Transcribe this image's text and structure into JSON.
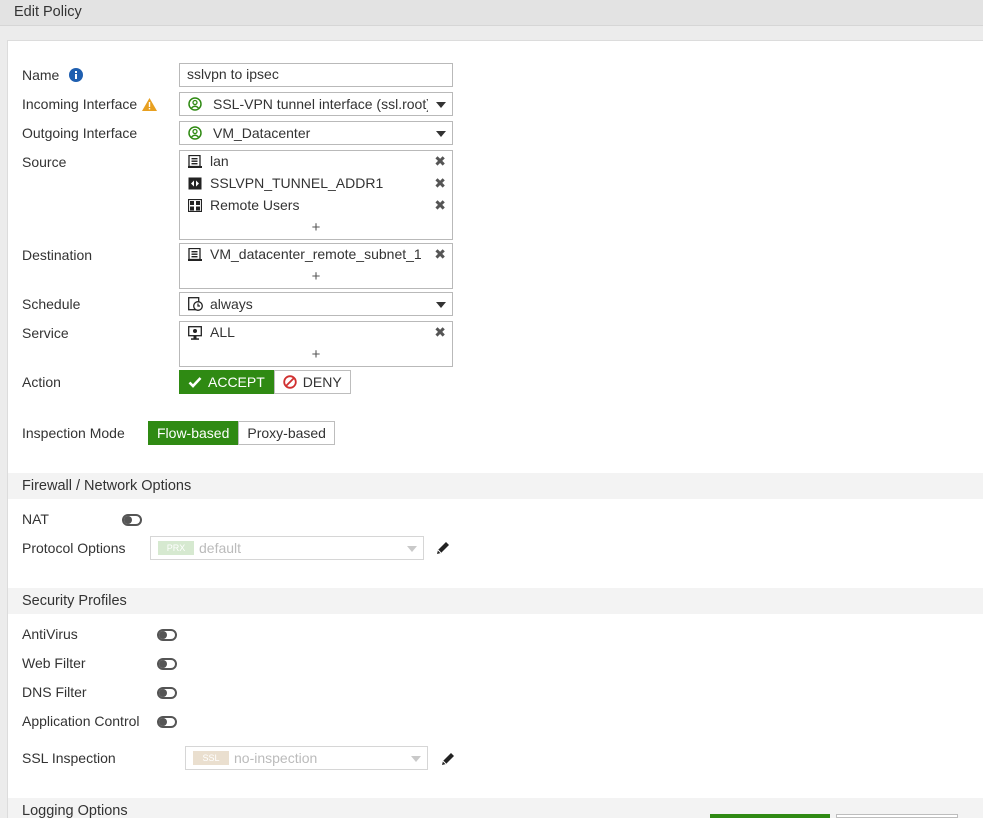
{
  "title": "Edit Policy",
  "form": {
    "name": {
      "label": "Name",
      "value": "sslvpn to ipsec"
    },
    "incoming": {
      "label": "Incoming Interface",
      "value": "SSL-VPN tunnel interface (ssl.root)"
    },
    "outgoing": {
      "label": "Outgoing Interface",
      "value": "VM_Datacenter"
    },
    "source": {
      "label": "Source",
      "items": [
        "lan",
        "SSLVPN_TUNNEL_ADDR1",
        "Remote Users"
      ]
    },
    "destination": {
      "label": "Destination",
      "items": [
        "VM_datacenter_remote_subnet_1"
      ]
    },
    "schedule": {
      "label": "Schedule",
      "value": "always"
    },
    "service": {
      "label": "Service",
      "items": [
        "ALL"
      ]
    },
    "action": {
      "label": "Action",
      "accept": "ACCEPT",
      "deny": "DENY",
      "selected": "ACCEPT"
    },
    "inspection": {
      "label": "Inspection Mode",
      "flow": "Flow-based",
      "proxy": "Proxy-based",
      "selected": "Flow-based"
    },
    "add_symbol": "+",
    "remove_symbol": "✖"
  },
  "firewall": {
    "section_title": "Firewall / Network Options",
    "nat_label": "NAT",
    "nat_enabled": false,
    "protocol_label": "Protocol Options",
    "protocol_tag": "PRX",
    "protocol_value": "default"
  },
  "security": {
    "section_title": "Security Profiles",
    "antivirus": "AntiVirus",
    "webfilter": "Web Filter",
    "dnsfilter": "DNS Filter",
    "appcontrol": "Application Control",
    "ssl_label": "SSL Inspection",
    "ssl_tag": "SSL",
    "ssl_value": "no-inspection"
  },
  "logging": {
    "section_title": "Logging Options"
  },
  "colors": {
    "accept_green": "#2f8a13",
    "deny_red": "#d03030",
    "info_blue": "#1f5fb0",
    "warn_orange": "#e8a020"
  }
}
